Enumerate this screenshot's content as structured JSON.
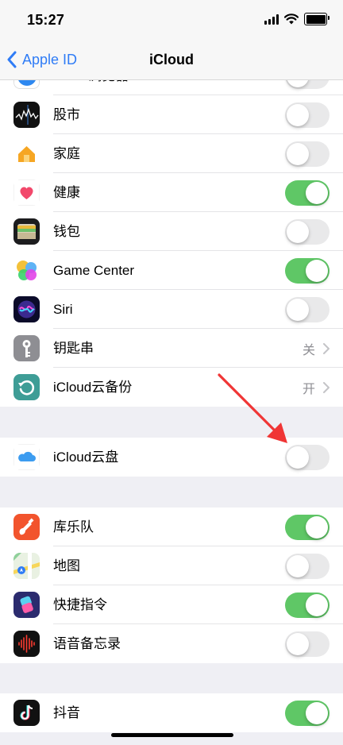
{
  "status_bar": {
    "time": "15:27"
  },
  "nav": {
    "back_label": "Apple ID",
    "title": "iCloud"
  },
  "group1": [
    {
      "label": "Safari浏览器",
      "icon": "safari-icon",
      "control": "toggle",
      "on": false
    },
    {
      "label": "股市",
      "icon": "stocks-icon",
      "control": "toggle",
      "on": false
    },
    {
      "label": "家庭",
      "icon": "home-icon",
      "control": "toggle",
      "on": false
    },
    {
      "label": "健康",
      "icon": "health-icon",
      "control": "toggle",
      "on": true
    },
    {
      "label": "钱包",
      "icon": "wallet-icon",
      "control": "toggle",
      "on": false
    },
    {
      "label": "Game Center",
      "icon": "game-center-icon",
      "control": "toggle",
      "on": true
    },
    {
      "label": "Siri",
      "icon": "siri-icon",
      "control": "toggle",
      "on": false
    },
    {
      "label": "钥匙串",
      "icon": "keychain-icon",
      "control": "detail",
      "value": "关"
    },
    {
      "label": "iCloud云备份",
      "icon": "icloud-backup-icon",
      "control": "detail",
      "value": "开"
    }
  ],
  "group2": [
    {
      "label": "iCloud云盘",
      "icon": "icloud-drive-icon",
      "control": "toggle",
      "on": false
    }
  ],
  "group3": [
    {
      "label": "库乐队",
      "icon": "garageband-icon",
      "control": "toggle",
      "on": true
    },
    {
      "label": "地图",
      "icon": "maps-icon",
      "control": "toggle",
      "on": false
    },
    {
      "label": "快捷指令",
      "icon": "shortcuts-icon",
      "control": "toggle",
      "on": true
    },
    {
      "label": "语音备忘录",
      "icon": "voice-memos-icon",
      "control": "toggle",
      "on": false
    }
  ],
  "group4": [
    {
      "label": "抖音",
      "icon": "douyin-icon",
      "control": "toggle",
      "on": true
    }
  ],
  "colors": {
    "accent": "#2f7cf6",
    "toggle_on": "#5fc766",
    "toggle_off": "#e9e9ea",
    "annotation_arrow": "#f03535"
  }
}
